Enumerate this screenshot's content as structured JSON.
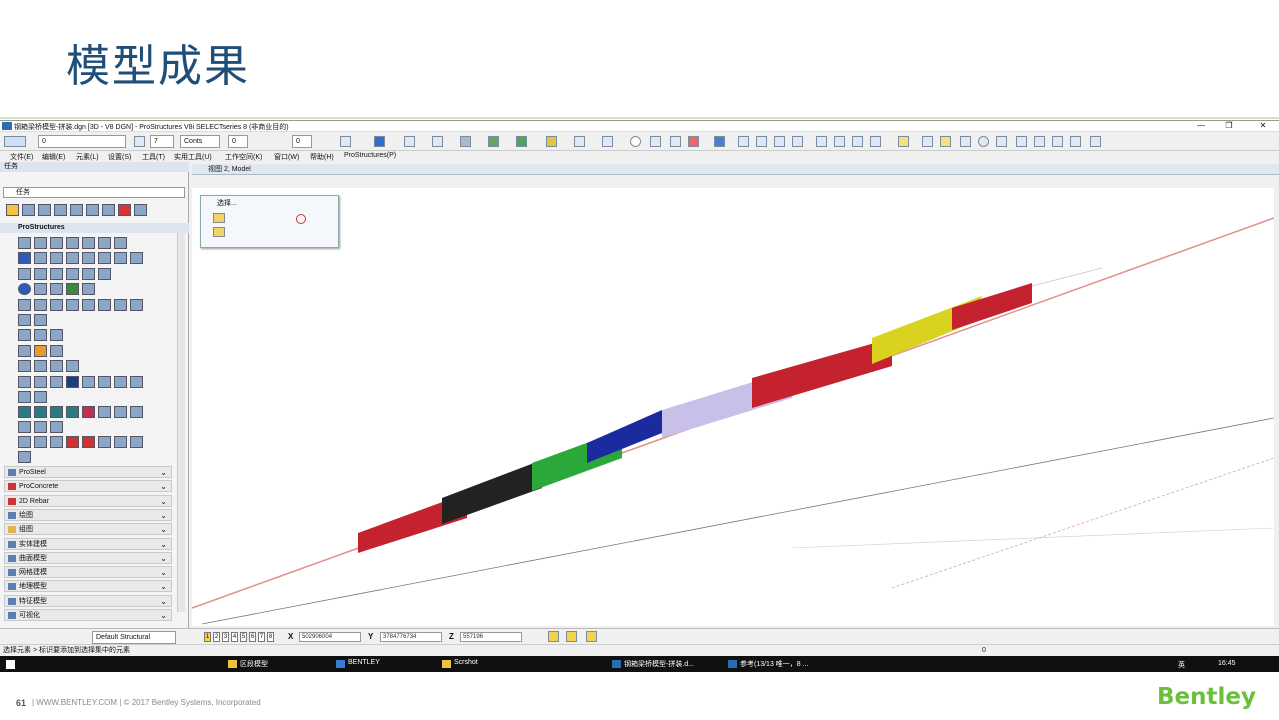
{
  "slide": {
    "title": "模型成果",
    "page_number": "61",
    "footer_text": "|  WWW.BENTLEY.COM  |   © 2017 Bentley Systems, Incorporated",
    "logo": "Bentley"
  },
  "window": {
    "title": "钢箱梁桥模型-拼装.dgn [3D - V8 DGN] - ProStructures V8i SELECTseries 8 (非商业目的)",
    "min": "—",
    "max": "❐",
    "close": "✕"
  },
  "toolbar": {
    "level_combo": "0",
    "weight": "7",
    "style": "Conts",
    "level2": "0",
    "transparency": "0"
  },
  "menu": [
    "文件(E)",
    "编辑(E)",
    "元素(L)",
    "设置(S)",
    "工具(T)",
    "实用工具(U)",
    "工作空间(K)",
    "窗口(W)",
    "帮助(H)",
    "ProStructures(P)"
  ],
  "task_panel": {
    "header": "任务",
    "combo": "任务",
    "group": "ProStructures",
    "sections": [
      "ProSteel",
      "ProConcrete",
      "2D Rebar",
      "绘图",
      "组图",
      "实体建模",
      "曲面模型",
      "网格建模",
      "地理模型",
      "特征模型",
      "可视化"
    ]
  },
  "view": {
    "title": "视图 2, Model"
  },
  "select_popup": {
    "title": "选择..."
  },
  "status": {
    "default_level": "Default Structural",
    "pages": [
      "1",
      "2",
      "3",
      "4",
      "5",
      "6",
      "7",
      "8"
    ],
    "x_label": "X",
    "x_value": "502906004",
    "y_label": "Y",
    "y_value": "3784776734",
    "z_label": "Z",
    "z_value": "557196",
    "message": "选择元素 > 标识要添加到选择集中的元素",
    "level_right": "0"
  },
  "taskbar": {
    "items": [
      "区段模型",
      "BENTLEY",
      "Scrshot",
      "钢箱梁桥模型-拼装.d...",
      "参考(13/13 唯一，8 ..."
    ],
    "clock": "16:45",
    "ime": "英"
  },
  "colors": {
    "title": "#1f4e79",
    "logo": "#6cbf3b",
    "taskbar": "#101010"
  }
}
